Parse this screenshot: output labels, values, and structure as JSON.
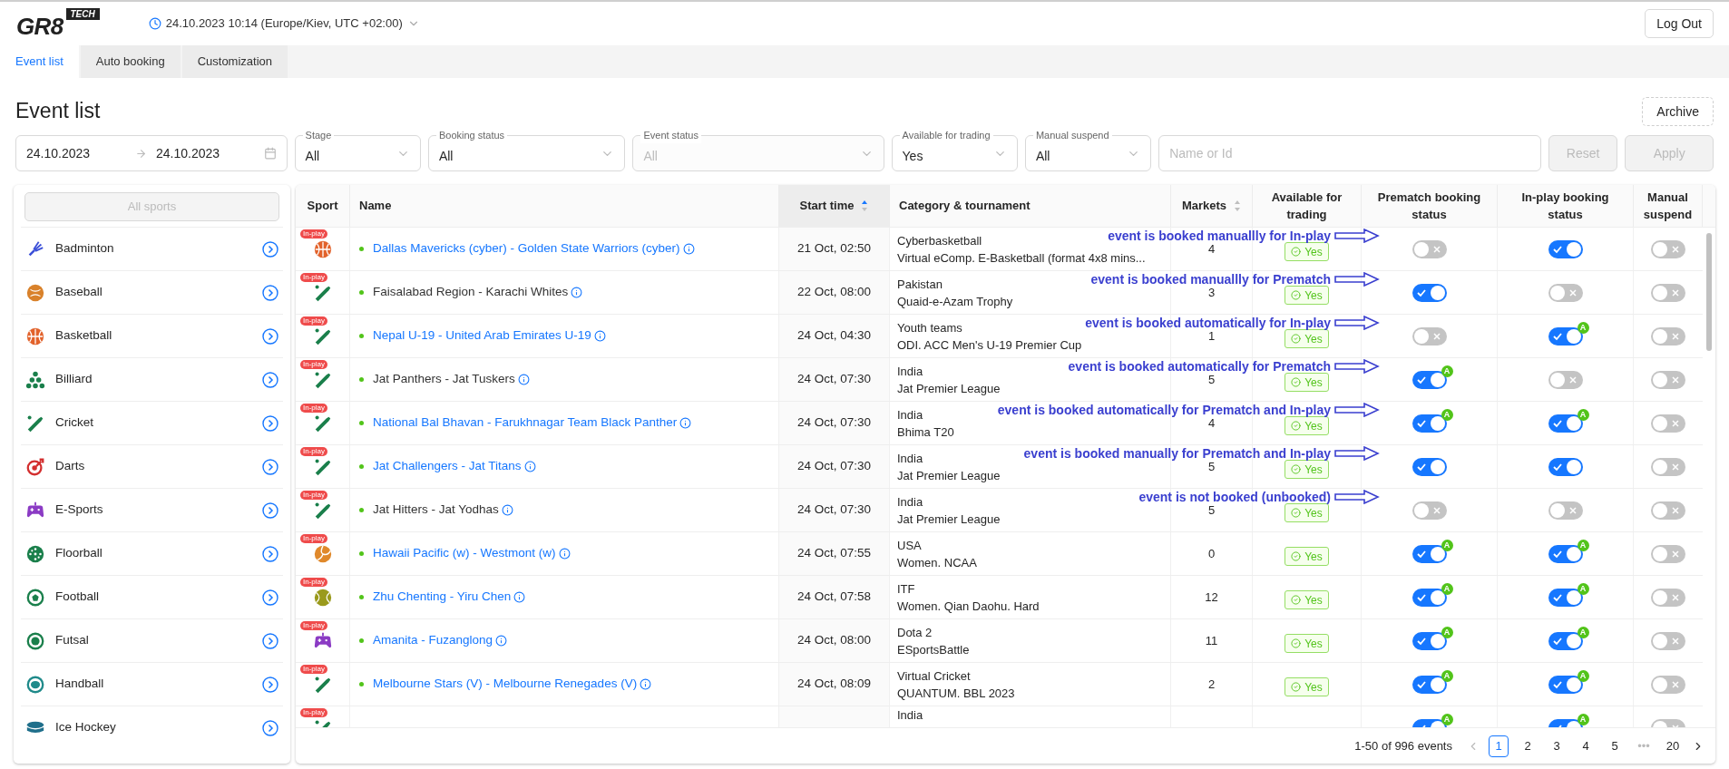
{
  "header": {
    "logo": "GR8",
    "logo_badge": "TECH",
    "datetime": "24.10.2023 10:14 (Europe/Kiev, UTC +02:00)",
    "logout": "Log Out"
  },
  "tabs": [
    {
      "label": "Event list",
      "selected": true
    },
    {
      "label": "Auto booking",
      "selected": false
    },
    {
      "label": "Customization",
      "selected": false
    }
  ],
  "title": "Event list",
  "archive": "Archive",
  "filters": {
    "date_from": "24.10.2023",
    "date_to": "24.10.2023",
    "selects": [
      {
        "label": "Stage",
        "value": "All",
        "disabled": false
      },
      {
        "label": "Booking status",
        "value": "All",
        "disabled": false
      },
      {
        "label": "Event status",
        "value": "All",
        "disabled": true
      },
      {
        "label": "Available for trading",
        "value": "Yes",
        "disabled": false
      },
      {
        "label": "Manual suspend",
        "value": "All",
        "disabled": false
      }
    ],
    "search": {
      "placeholder": "Name or Id"
    },
    "buttons": [
      {
        "label": "Reset",
        "disabled": true
      },
      {
        "label": "Apply",
        "disabled": true
      }
    ]
  },
  "sidebar": {
    "all": "All sports",
    "items": [
      {
        "label": "Badminton",
        "kind": "badminton"
      },
      {
        "label": "Baseball",
        "kind": "baseball"
      },
      {
        "label": "Basketball",
        "kind": "basketball"
      },
      {
        "label": "Billiard",
        "kind": "billiard"
      },
      {
        "label": "Cricket",
        "kind": "cricket"
      },
      {
        "label": "Darts",
        "kind": "darts"
      },
      {
        "label": "E-Sports",
        "kind": "esports"
      },
      {
        "label": "Floorball",
        "kind": "floorball"
      },
      {
        "label": "Football",
        "kind": "football"
      },
      {
        "label": "Futsal",
        "kind": "futsal"
      },
      {
        "label": "Handball",
        "kind": "handball"
      },
      {
        "label": "Ice Hockey",
        "kind": "icehockey"
      }
    ]
  },
  "table": {
    "columns": [
      {
        "label": "Sport",
        "sortable": false,
        "sorted": false
      },
      {
        "label": "Name",
        "sortable": false,
        "sorted": false
      },
      {
        "label": "Start time",
        "sortable": true,
        "sorted": true
      },
      {
        "label": "Category & tournament",
        "sortable": false,
        "sorted": false
      },
      {
        "label": "Markets",
        "sortable": true,
        "sorted": false
      },
      {
        "label": "Available for trading",
        "sortable": false,
        "sorted": false
      },
      {
        "label": "Prematch booking status",
        "sortable": false,
        "sorted": false
      },
      {
        "label": "In-play booking status",
        "sortable": false,
        "sorted": false
      },
      {
        "label": "Manual suspend",
        "sortable": false,
        "sorted": false
      }
    ],
    "rows": [
      {
        "kind": "basketball",
        "badge": "In-play",
        "name": "Dallas Mavericks (cyber) - Golden State Warriors (cyber)",
        "link": true,
        "start": "21 Oct, 02:50",
        "category": "Cyberbasketball",
        "tournament": "Virtual eComp. E-Basketball (format 4x8 mins...",
        "markets": "4",
        "trading": "Yes",
        "prematch": {
          "on": false
        },
        "inplay": {
          "on": true
        },
        "suspend": {
          "on": false
        },
        "note": "event is booked manuallly for In-play"
      },
      {
        "kind": "cricket",
        "badge": "In-play",
        "name": "Faisalabad Region - Karachi Whites",
        "link": false,
        "start": "22 Oct, 08:00",
        "category": "Pakistan",
        "tournament": "Quaid-e-Azam Trophy",
        "markets": "3",
        "trading": "Yes",
        "prematch": {
          "on": true
        },
        "inplay": {
          "on": false
        },
        "suspend": {
          "on": false
        },
        "note": "event is booked manuallly for Prematch"
      },
      {
        "kind": "cricket",
        "badge": "In-play",
        "name": "Nepal U-19 - United Arab Emirates U-19",
        "link": true,
        "start": "24 Oct, 04:30",
        "category": "Youth teams",
        "tournament": "ODI. ACC Men's U-19 Premier Cup",
        "markets": "1",
        "trading": "Yes",
        "prematch": {
          "on": false
        },
        "inplay": {
          "on": true,
          "badge": "A"
        },
        "suspend": {
          "on": false
        },
        "note": "event is booked automatically for In-play"
      },
      {
        "kind": "cricket",
        "badge": "In-play",
        "name": "Jat Panthers - Jat Tuskers",
        "link": false,
        "start": "24 Oct, 07:30",
        "category": "India",
        "tournament": "Jat Premier League",
        "markets": "5",
        "trading": "Yes",
        "prematch": {
          "on": true,
          "badge": "A"
        },
        "inplay": {
          "on": false
        },
        "suspend": {
          "on": false
        },
        "note": "event is booked automatically for Prematch"
      },
      {
        "kind": "cricket",
        "badge": "In-play",
        "name": "National Bal Bhavan - Farukhnagar Team Black Panther",
        "link": true,
        "start": "24 Oct, 07:30",
        "category": "India",
        "tournament": "Bhima T20",
        "markets": "4",
        "trading": "Yes",
        "prematch": {
          "on": true,
          "badge": "A"
        },
        "inplay": {
          "on": true,
          "badge": "A"
        },
        "suspend": {
          "on": false
        },
        "note": "event is booked automatically for Prematch and In-play"
      },
      {
        "kind": "cricket",
        "badge": "In-play",
        "name": "Jat Challengers - Jat Titans",
        "link": true,
        "start": "24 Oct, 07:30",
        "category": "India",
        "tournament": "Jat Premier League",
        "markets": "5",
        "trading": "Yes",
        "prematch": {
          "on": true
        },
        "inplay": {
          "on": true
        },
        "suspend": {
          "on": false
        },
        "note": "event is booked manually for Prematch and In-play"
      },
      {
        "kind": "cricket",
        "badge": "In-play",
        "name": "Jat Hitters - Jat Yodhas",
        "link": false,
        "start": "24 Oct, 07:30",
        "category": "India",
        "tournament": "Jat Premier League",
        "markets": "5",
        "trading": "Yes",
        "prematch": {
          "on": false
        },
        "inplay": {
          "on": false
        },
        "suspend": {
          "on": false
        },
        "note": "event is not booked (unbooked)"
      },
      {
        "kind": "volleyball",
        "badge": "In-play",
        "name": "Hawaii Pacific (w) - Westmont (w)",
        "link": true,
        "start": "24 Oct, 07:55",
        "category": "USA",
        "tournament": "Women. NCAA",
        "markets": "0",
        "trading": "Yes",
        "prematch": {
          "on": true,
          "badge": "A"
        },
        "inplay": {
          "on": true,
          "badge": "A"
        },
        "suspend": {
          "on": false
        }
      },
      {
        "kind": "tennis",
        "badge": "In-play",
        "name": "Zhu Chenting - Yiru Chen",
        "link": true,
        "start": "24 Oct, 07:58",
        "category": "ITF",
        "tournament": "Women. Qian Daohu. Hard",
        "markets": "12",
        "trading": "Yes",
        "prematch": {
          "on": true,
          "badge": "A"
        },
        "inplay": {
          "on": true,
          "badge": "A"
        },
        "suspend": {
          "on": false
        }
      },
      {
        "kind": "esports",
        "badge": "In-play",
        "name": "Amanita - Fuzanglong",
        "link": true,
        "start": "24 Oct, 08:00",
        "category": "Dota 2",
        "tournament": "ESportsBattle",
        "markets": "11",
        "trading": "Yes",
        "prematch": {
          "on": true,
          "badge": "A"
        },
        "inplay": {
          "on": true,
          "badge": "A"
        },
        "suspend": {
          "on": false
        }
      },
      {
        "kind": "cricket",
        "badge": "In-play",
        "name": "Melbourne Stars (V) - Melbourne Renegades (V)",
        "link": true,
        "start": "24 Oct, 08:09",
        "category": "Virtual Cricket",
        "tournament": "QUANTUM. BBL 2023",
        "markets": "2",
        "trading": "Yes",
        "prematch": {
          "on": true,
          "badge": "A"
        },
        "inplay": {
          "on": true,
          "badge": "A"
        },
        "suspend": {
          "on": false
        }
      },
      {
        "kind": "cricket",
        "badge": "In-play",
        "category": "India",
        "prematch": {
          "on": true,
          "badge": "A"
        },
        "inplay": {
          "on": true,
          "badge": "A"
        },
        "suspend": {
          "on": false
        }
      }
    ]
  },
  "pagination": {
    "summary": "1-50 of 996 events",
    "pages": [
      {
        "label": "1",
        "selected": true
      },
      {
        "label": "2",
        "selected": false
      },
      {
        "label": "3",
        "selected": false
      },
      {
        "label": "4",
        "selected": false
      },
      {
        "label": "5",
        "selected": false
      },
      {
        "label": "•••",
        "kind": "ellipsis",
        "selected": false
      },
      {
        "label": "20",
        "selected": false
      }
    ]
  }
}
